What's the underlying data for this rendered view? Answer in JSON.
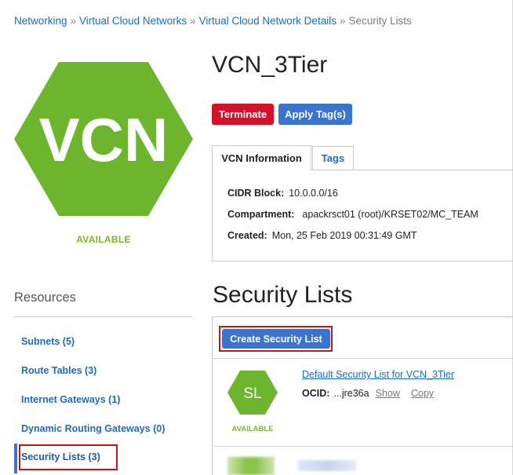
{
  "breadcrumb": {
    "items": [
      "Networking",
      "Virtual Cloud Networks",
      "Virtual Cloud Network Details"
    ],
    "separator": "»",
    "current": "Security Lists"
  },
  "vcn": {
    "icon_text": "VCN",
    "status": "AVAILABLE",
    "name": "VCN_3Tier",
    "accent_color": "#6eb52e"
  },
  "actions": {
    "terminate": "Terminate",
    "apply_tags": "Apply Tag(s)"
  },
  "tabs": {
    "info": "VCN Information",
    "tags": "Tags"
  },
  "info": {
    "cidr_label": "CIDR Block:",
    "cidr_value": "10.0.0.0/16",
    "compartment_label": "Compartment:",
    "compartment_value": "apackrsct01 (root)/KRSET02/MC_TEAM",
    "created_label": "Created:",
    "created_value": "Mon, 25 Feb 2019 00:31:49 GMT"
  },
  "resources": {
    "title": "Resources",
    "items": [
      {
        "label": "Subnets (5)"
      },
      {
        "label": "Route Tables (3)"
      },
      {
        "label": "Internet Gateways (1)"
      },
      {
        "label": "Dynamic Routing Gateways (0)"
      },
      {
        "label": "Security Lists (3)"
      }
    ]
  },
  "security_lists": {
    "title": "Security Lists",
    "create_button": "Create Security List",
    "items": [
      {
        "icon_text": "SL",
        "status": "AVAILABLE",
        "name": "Default Security List for VCN_3Tier",
        "ocid_label": "OCID:",
        "ocid_value": "...jre36a",
        "show": "Show",
        "copy": "Copy"
      }
    ]
  },
  "colors": {
    "link": "#1f6bbf",
    "danger": "#d2112b",
    "primary": "#3a74cc",
    "available": "#7bb52f",
    "highlight": "#c4161c"
  }
}
